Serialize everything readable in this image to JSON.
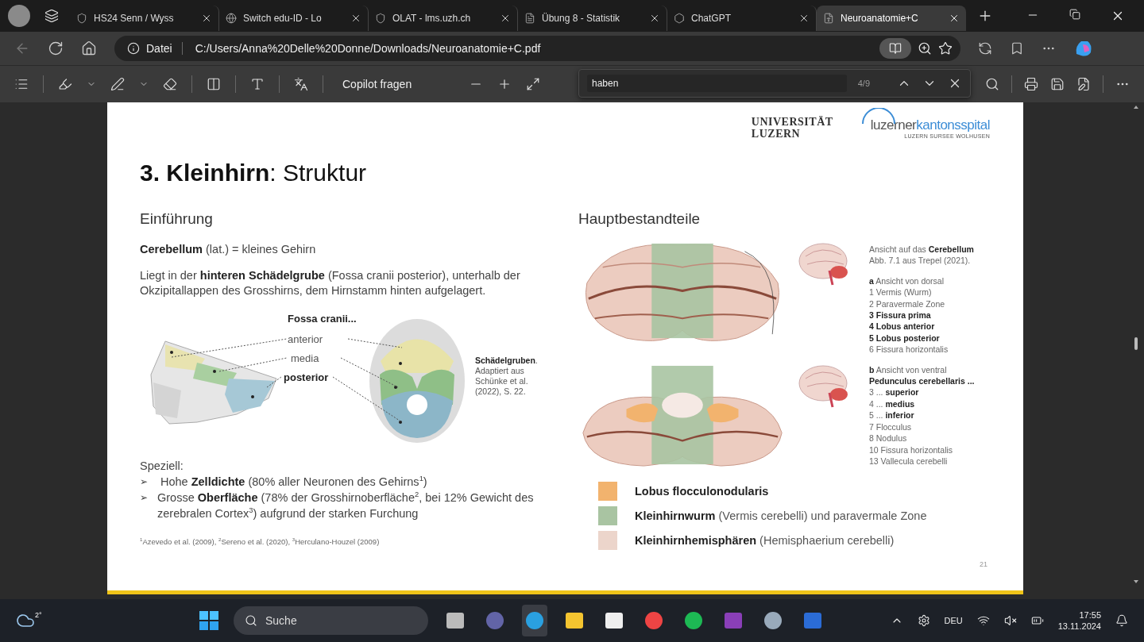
{
  "browser": {
    "tabs": [
      {
        "title": "HS24 Senn / Wyss",
        "selected": false
      },
      {
        "title": "Switch edu-ID - Lo",
        "selected": false
      },
      {
        "title": "OLAT - lms.uzh.ch",
        "selected": false
      },
      {
        "title": "Übung 8 - Statistik",
        "selected": false
      },
      {
        "title": "ChatGPT",
        "selected": false
      },
      {
        "title": "Neuroanatomie+C",
        "selected": true
      }
    ],
    "address": {
      "scheme_label": "Datei",
      "url": "C:/Users/Anna%20Delle%20Donne/Downloads/Neuroanatomie+C.pdf"
    }
  },
  "pdf_toolbar": {
    "ask_label": "Copilot fragen",
    "find": {
      "value": "haben",
      "count": "4/9"
    }
  },
  "slide": {
    "logos": {
      "university": "UNIVERSITÄT LUZERN",
      "hospital_first": "luzerner",
      "hospital_second": "kantonsspital",
      "hospital_places": "LUZERN SURSEE WOLHUSEN"
    },
    "title": "**3. Kleinhirn**: Struktur",
    "left": {
      "heading": "Einführung",
      "definition": "**Cerebellum** (lat.) = kleines Gehirn",
      "location": "Liegt in der **hinteren Schädelgrube** (Fossa cranii posterior), unterhalb der Okzipitallappen des Grosshirns, dem Hirnstamm hinten aufgelagert.",
      "figure": {
        "label_title": "Fossa cranii...",
        "labels": [
          {
            "text": "anterior",
            "emphasized": false
          },
          {
            "text": "media",
            "emphasized": false
          },
          {
            "text": "posterior",
            "emphasized": true
          }
        ],
        "caption": "**Schädelgruben**. Adaptiert aus Schünke et al. (2022), S. 22."
      },
      "special": {
        "intro": "Speziell:",
        "items": [
          {
            "marker": "➢",
            "text": "Hohe **Zelldichte** (80% aller Neuronen des Gehirns$^{1}$)"
          },
          {
            "marker": "➢",
            "text": "Grosse **Oberfläche** (78% der Grosshirnoberfläche$^{2}$, bei 12% Gewicht des zerebralen Cortex$^{3}$) aufgrund der starken Furchung"
          }
        ]
      },
      "footnote": "$^{1}$Azevedo et al. (2009), $^{2}$Sereno et al. (2020), $^{3}$Herculano-Houzel (2009)"
    },
    "right": {
      "heading": "Hauptbestandteile",
      "caption_blocks": [
        [
          {
            "text": "Ansicht auf das **Cerebellum**",
            "bold": false
          },
          {
            "text": "Abb. 7.1 aus Trepel (2021).",
            "bold": false
          }
        ],
        [
          {
            "text": "**a** Ansicht von dorsal",
            "bold": false
          },
          {
            "text": "1 Vermis (Wurm)",
            "bold": false
          },
          {
            "text": "2 Paravermale Zone",
            "bold": false
          },
          {
            "text": "3 Fissura prima",
            "bold": true
          },
          {
            "text": "4 Lobus anterior",
            "bold": true
          },
          {
            "text": "5 Lobus posterior",
            "bold": true
          },
          {
            "text": "6 Fissura horizontalis",
            "bold": false
          }
        ],
        [
          {
            "text": "**b** Ansicht von ventral",
            "bold": false
          },
          {
            "text": "Pedunculus cerebellaris ...",
            "bold": true
          },
          {
            "text": "3 ... **superior**",
            "bold": false
          },
          {
            "text": "4 ... **medius**",
            "bold": false
          },
          {
            "text": "5 ... **inferior**",
            "bold": false
          },
          {
            "text": "7 Flocculus",
            "bold": false
          },
          {
            "text": "8 Nodulus",
            "bold": false
          },
          {
            "text": "10 Fissura horizontalis",
            "bold": false
          },
          {
            "text": "13 Vallecula cerebelli",
            "bold": false
          }
        ]
      ],
      "legend": [
        {
          "color": "#f2b36e",
          "term": "Lobus flocculonodularis"
        },
        {
          "color": "#a9c4a2",
          "term": "Kleinhirnwurm",
          "note": "(Vermis cerebelli) und paravermale Zone"
        },
        {
          "color": "#ecd5cb",
          "term": "Kleinhirnhemisphären",
          "note": "(Hemisphaerium cerebelli)"
        }
      ]
    },
    "page_number": "21"
  },
  "taskbar": {
    "weather": "2°",
    "placeholder": "Suche",
    "language": "DEU",
    "time": "17:55",
    "date": "13.11.2024"
  }
}
